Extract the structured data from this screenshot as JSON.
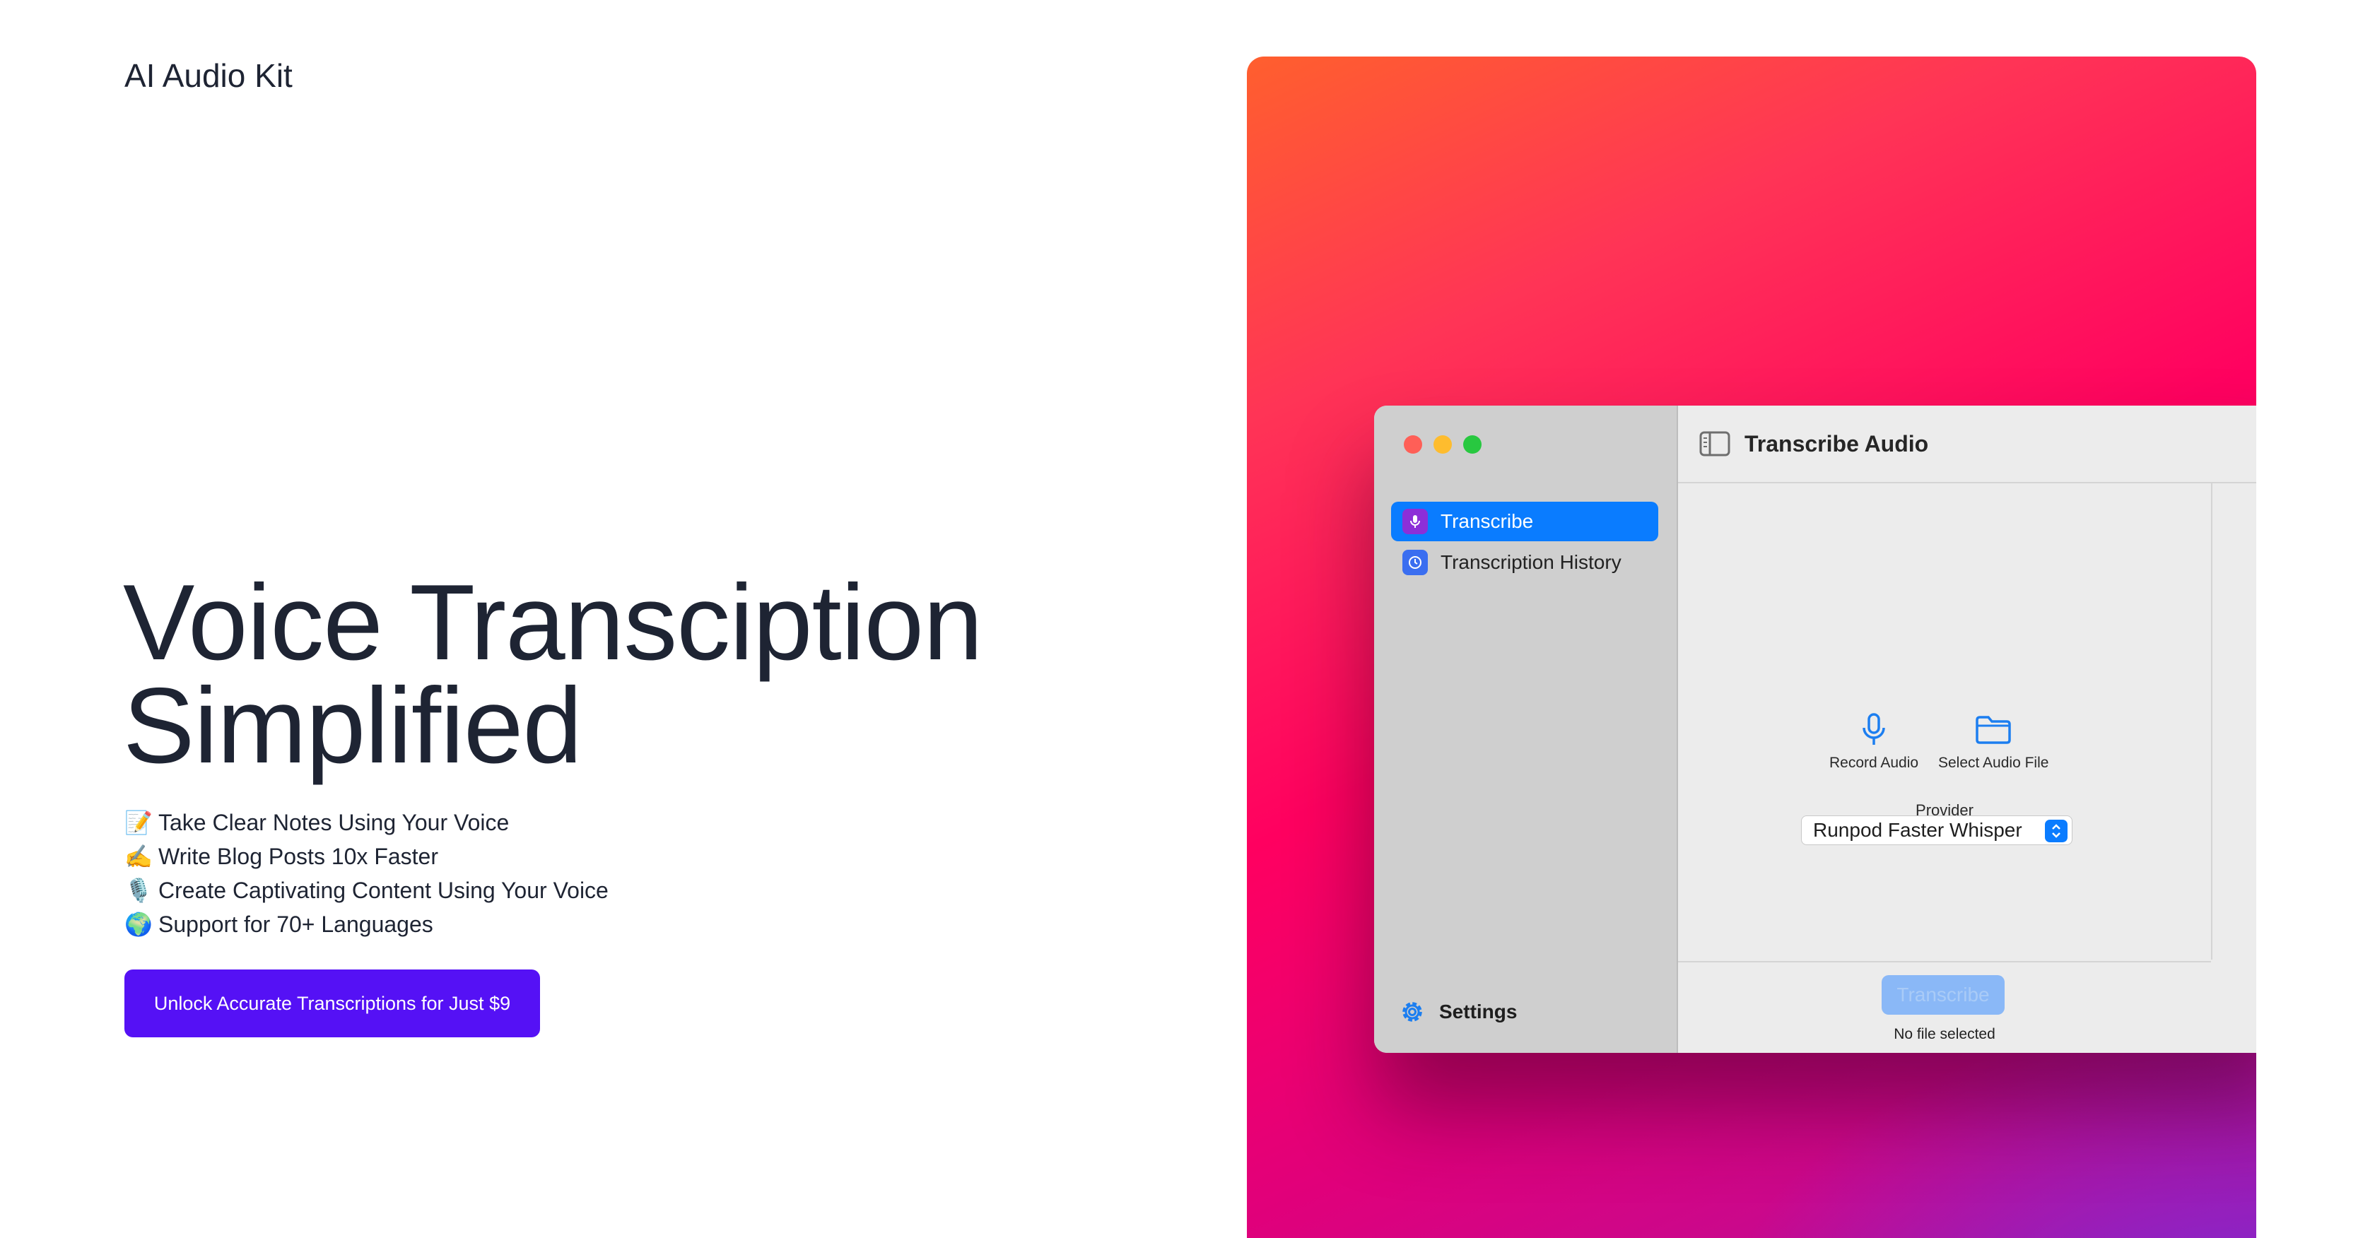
{
  "brand": "AI Audio Kit",
  "hero": {
    "title_line1": "Voice Transciption",
    "title_line2": "Simplified",
    "features": [
      {
        "emoji": "📝",
        "text": "Take Clear Notes Using Your Voice"
      },
      {
        "emoji": "✍️",
        "text": "Write Blog Posts 10x Faster"
      },
      {
        "emoji": "🎙️",
        "text": "Create Captivating Content Using Your Voice"
      },
      {
        "emoji": "🌍",
        "text": "Support for 70+ Languages"
      }
    ],
    "cta_label": "Unlock Accurate Transcriptions for Just $9"
  },
  "app": {
    "sidebar": {
      "items": [
        {
          "label": "Transcribe",
          "icon": "microphone-icon",
          "active": true
        },
        {
          "label": "Transcription History",
          "icon": "clock-icon",
          "active": false
        }
      ],
      "settings_label": "Settings"
    },
    "toolbar": {
      "title": "Transcribe Audio"
    },
    "actions": {
      "record_label": "Record Audio",
      "select_label": "Select Audio File"
    },
    "provider": {
      "label": "Provider",
      "selected": "Runpod Faster Whisper"
    },
    "transcribe_label": "Transcribe",
    "file_status": "No file selected"
  },
  "colors": {
    "cta": "#5511f5",
    "accent": "#0a7cff",
    "text": "#1e2433"
  }
}
